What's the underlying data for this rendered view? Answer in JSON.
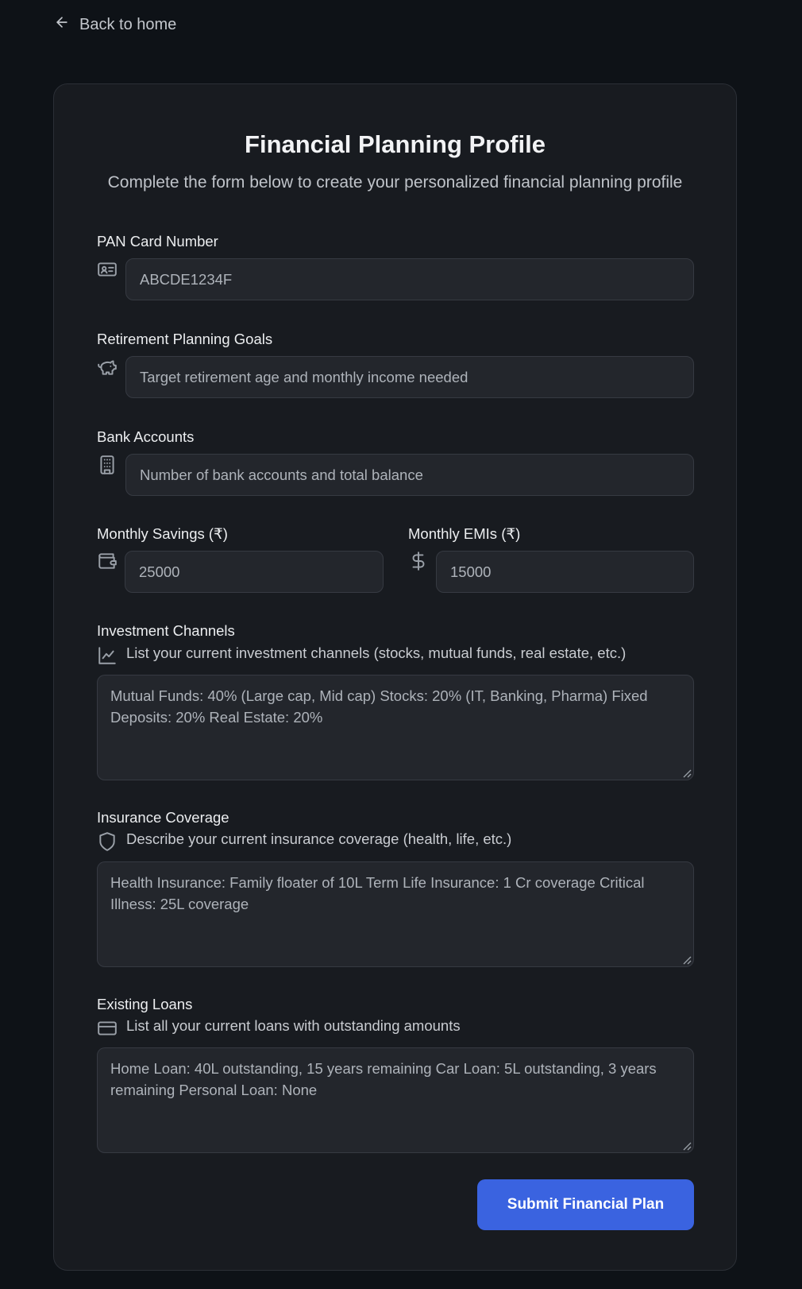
{
  "nav": {
    "back_label": "Back to home"
  },
  "form": {
    "title": "Financial Planning Profile",
    "subtitle": "Complete the form below to create your personalized financial planning profile",
    "pan": {
      "label": "PAN Card Number",
      "placeholder": "ABCDE1234F",
      "icon": "id-card-icon"
    },
    "retirement": {
      "label": "Retirement Planning Goals",
      "placeholder": "Target retirement age and monthly income needed",
      "icon": "piggy-bank-icon"
    },
    "bank": {
      "label": "Bank Accounts",
      "placeholder": "Number of bank accounts and total balance",
      "icon": "building-icon"
    },
    "savings": {
      "label": "Monthly Savings (₹)",
      "placeholder": "25000",
      "icon": "wallet-icon"
    },
    "emis": {
      "label": "Monthly EMIs (₹)",
      "placeholder": "15000",
      "icon": "dollar-icon"
    },
    "investments": {
      "label": "Investment Channels",
      "hint": "List your current investment channels (stocks, mutual funds, real estate, etc.)",
      "placeholder": "Mutual Funds: 40% (Large cap, Mid cap) Stocks: 20% (IT, Banking, Pharma) Fixed Deposits: 20% Real Estate: 20%",
      "icon": "line-chart-icon"
    },
    "insurance": {
      "label": "Insurance Coverage",
      "hint": "Describe your current insurance coverage (health, life, etc.)",
      "placeholder": "Health Insurance: Family floater of 10L Term Life Insurance: 1 Cr coverage Critical Illness: 25L coverage",
      "icon": "shield-icon"
    },
    "loans": {
      "label": "Existing Loans",
      "hint": "List all your current loans with outstanding amounts",
      "placeholder": "Home Loan: 40L outstanding, 15 years remaining Car Loan: 5L outstanding, 3 years remaining Personal Loan: None",
      "icon": "credit-card-icon"
    },
    "submit_label": "Submit Financial Plan"
  },
  "colors": {
    "background": "#0e1217",
    "card": "#181b20",
    "input": "#23262c",
    "accent": "#3a63e0"
  }
}
